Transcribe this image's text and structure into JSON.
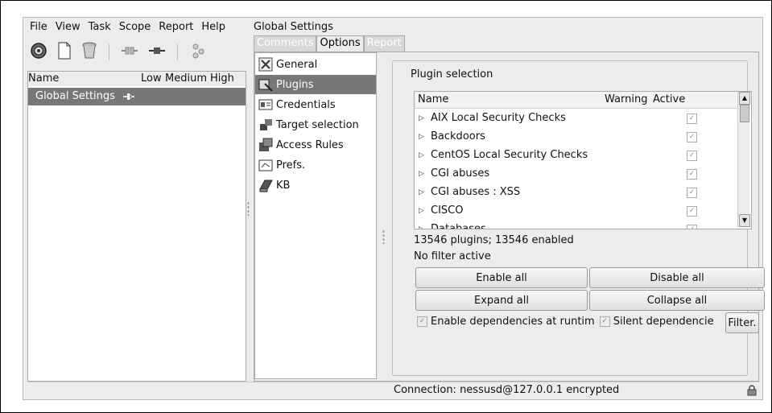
{
  "menu": [
    "File",
    "View",
    "Task",
    "Scope",
    "Report",
    "Help"
  ],
  "toolbar_icons": [
    "globe-icon",
    "new-document-icon",
    "trash-icon",
    "disconnect-icon",
    "connect-icon",
    "users-icon"
  ],
  "tree": {
    "headers": {
      "name": "Name",
      "low": "Low",
      "medium": "Medium",
      "high": "High"
    },
    "selected_item": "Global Settings"
  },
  "settings": {
    "title": "Global Settings",
    "tabs": [
      "Comments",
      "Options",
      "Report"
    ],
    "active_tab": "Options"
  },
  "nav": [
    {
      "label": "General",
      "icon": "general-icon"
    },
    {
      "label": "Plugins",
      "icon": "plugins-icon",
      "selected": true
    },
    {
      "label": "Credentials",
      "icon": "credentials-icon"
    },
    {
      "label": "Target selection",
      "icon": "target-icon"
    },
    {
      "label": "Access Rules",
      "icon": "access-rules-icon"
    },
    {
      "label": "Prefs.",
      "icon": "prefs-icon"
    },
    {
      "label": "KB",
      "icon": "kb-icon"
    }
  ],
  "plugins": {
    "group_label": "Plugin selection",
    "columns": {
      "name": "Name",
      "warning": "Warning",
      "active": "Active"
    },
    "rows": [
      {
        "name": "AIX Local Security Checks",
        "active": true
      },
      {
        "name": "Backdoors",
        "active": true
      },
      {
        "name": "CentOS Local Security Checks",
        "active": true
      },
      {
        "name": "CGI abuses",
        "active": true
      },
      {
        "name": "CGI abuses : XSS",
        "active": true
      },
      {
        "name": "CISCO",
        "active": true
      },
      {
        "name": "Databases",
        "active": true
      }
    ],
    "summary": "13546 plugins; 13546 enabled",
    "filter_status": "No filter active",
    "buttons": {
      "enable_all": "Enable all",
      "disable_all": "Disable all",
      "expand_all": "Expand all",
      "collapse_all": "Collapse all",
      "filter": "Filter."
    },
    "checkboxes": {
      "enable_dependencies": "Enable dependencies at runtim",
      "silent_dependencies": "Silent dependencie"
    }
  },
  "status": {
    "connection": "Connection: nessusd@127.0.0.1 encrypted"
  },
  "colors": {
    "selection": "#777777",
    "window_bg": "#ececec"
  }
}
